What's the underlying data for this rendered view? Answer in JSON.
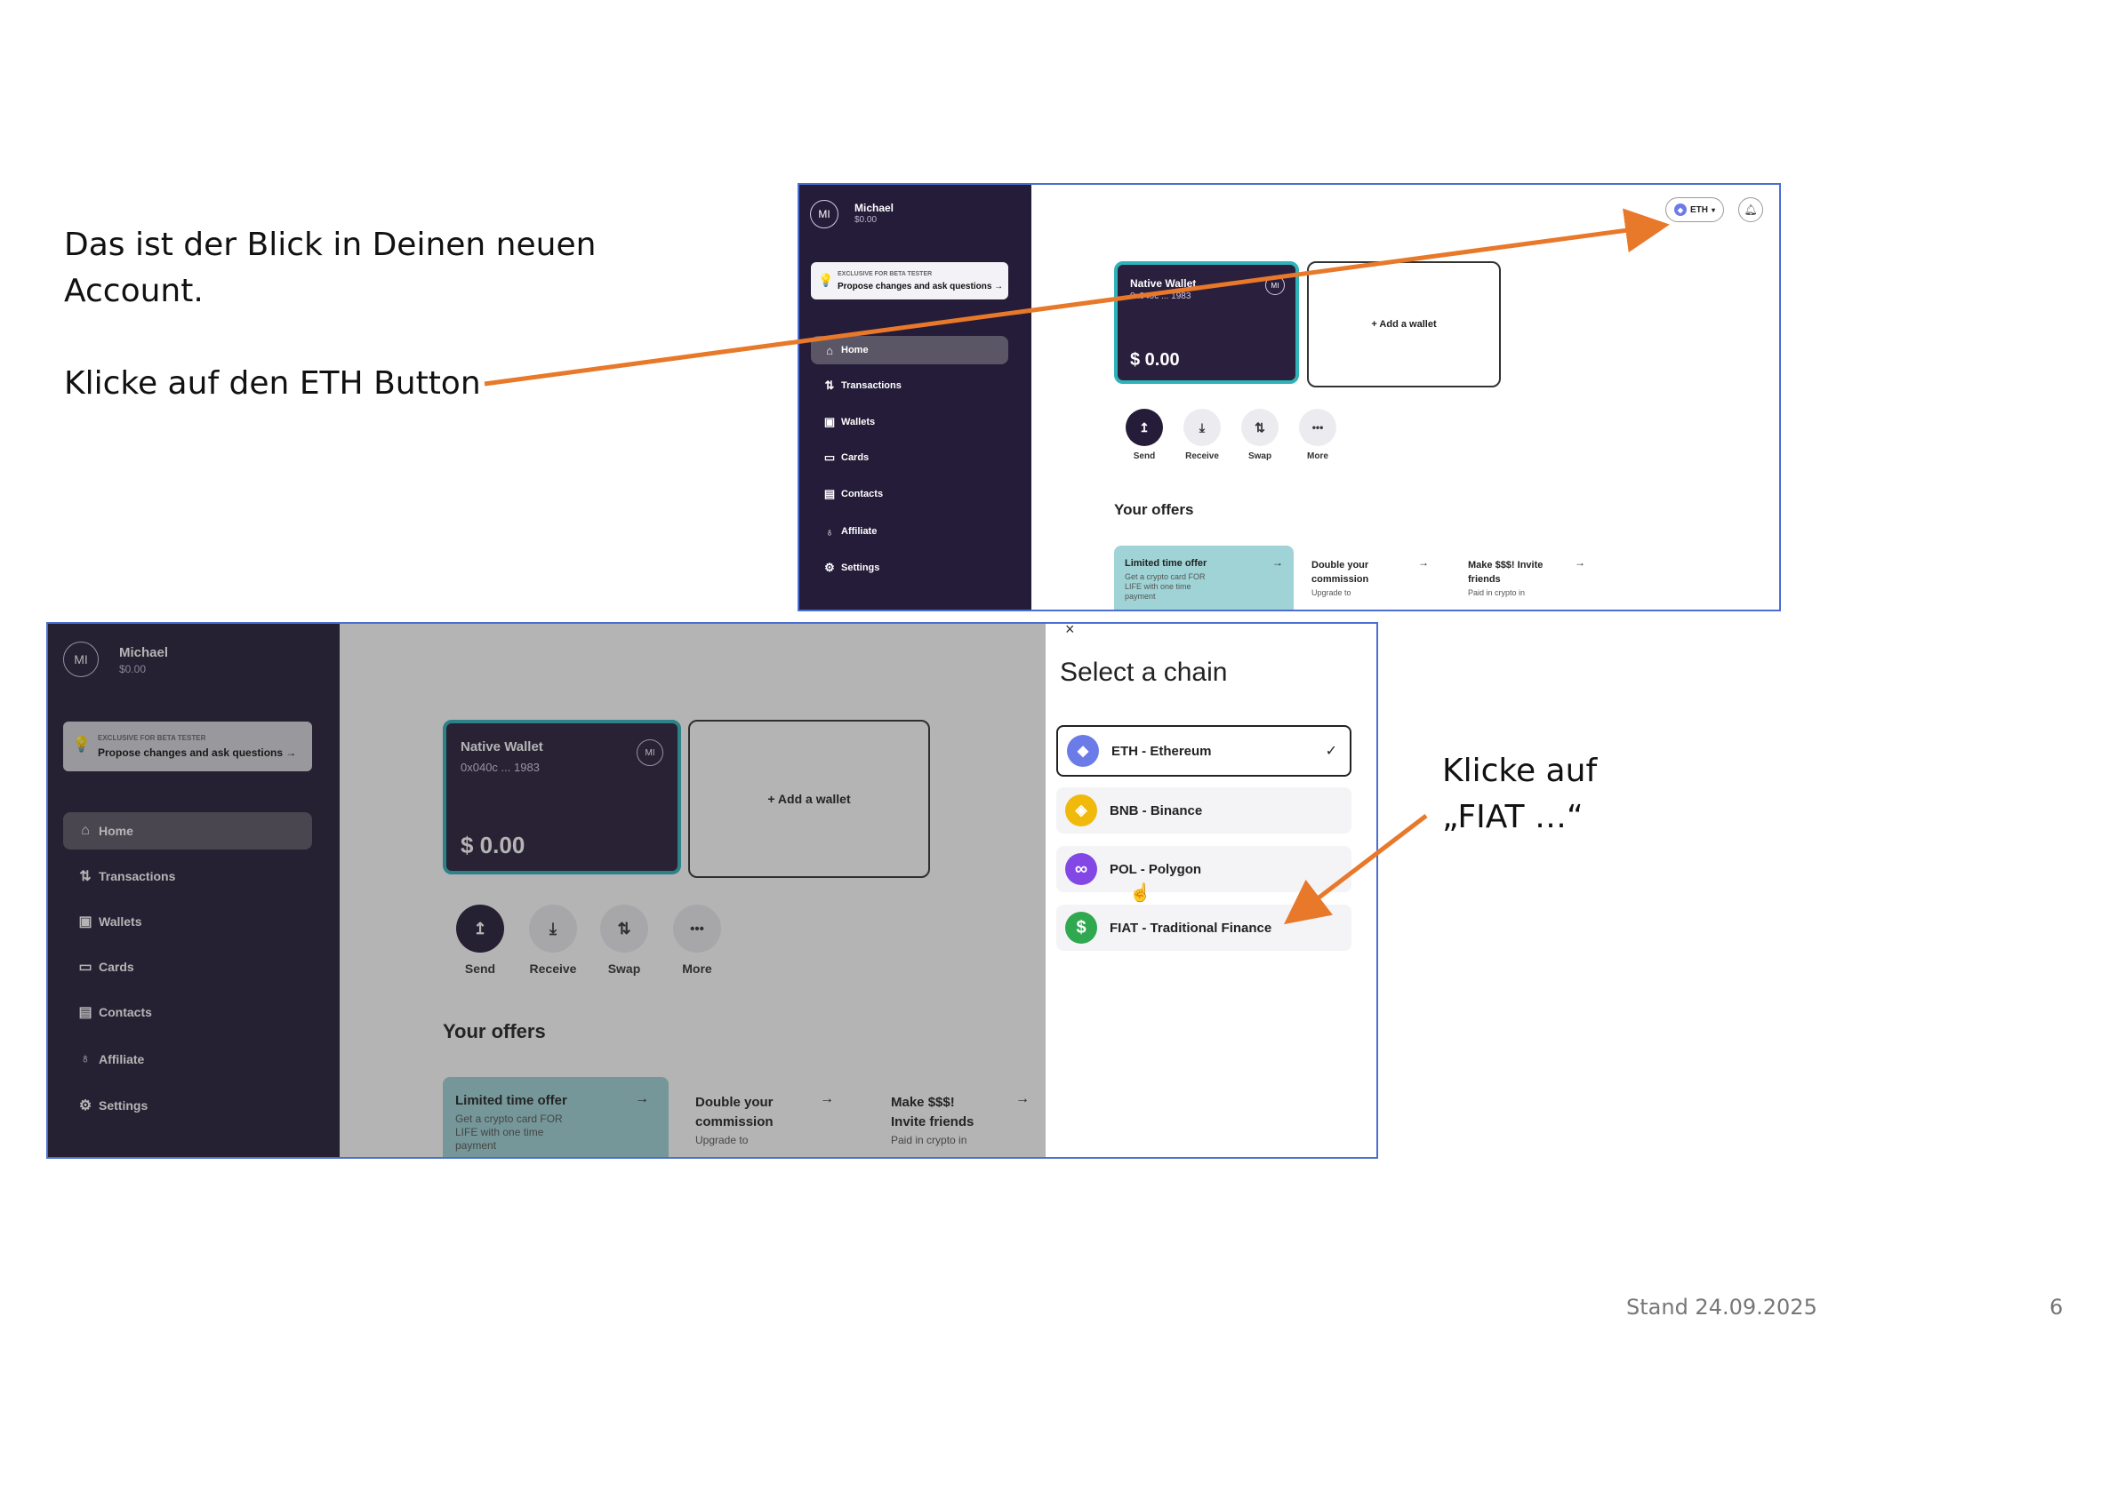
{
  "slide": {
    "intro_line1": "Das ist der Blick in Deinen neuen",
    "intro_line2": "Account.",
    "step1": "Klicke auf den ETH Button",
    "step2_line1": "Klicke auf",
    "step2_line2": "„FIAT …“",
    "footer_date": "Stand 24.09.2025",
    "page_number": "6"
  },
  "app": {
    "user": {
      "initials": "MI",
      "name": "Michael",
      "balance": "$0.00"
    },
    "beta": {
      "small": "EXCLUSIVE FOR BETA TESTER",
      "big": "Propose changes and ask questions →"
    },
    "nav": [
      {
        "label": "Home",
        "icon": "home-icon",
        "glyph": "⌂"
      },
      {
        "label": "Transactions",
        "icon": "transactions-icon",
        "glyph": "⇅"
      },
      {
        "label": "Wallets",
        "icon": "wallet-icon",
        "glyph": "▣"
      },
      {
        "label": "Cards",
        "icon": "card-icon",
        "glyph": "▭"
      },
      {
        "label": "Contacts",
        "icon": "contacts-icon",
        "glyph": "▤"
      },
      {
        "label": "Affiliate",
        "icon": "moneybag-icon",
        "glyph": "♁"
      },
      {
        "label": "Settings",
        "icon": "gear-icon",
        "glyph": "⚙"
      }
    ],
    "chain_button": "ETH",
    "wallet": {
      "name": "Native Wallet",
      "address": "0x040c ... 1983",
      "balance": "$ 0.00",
      "badge": "MI"
    },
    "add_wallet": "+ Add a wallet",
    "actions": [
      {
        "label": "Send",
        "glyph": "↥"
      },
      {
        "label": "Receive",
        "glyph": "⤓"
      },
      {
        "label": "Swap",
        "glyph": "⇅"
      },
      {
        "label": "More",
        "glyph": "•••"
      }
    ],
    "offers_title": "Your offers",
    "offers": [
      {
        "title": "Limited time offer",
        "desc": "Get a crypto card FOR LIFE with one time payment",
        "arrow": "→"
      },
      {
        "title": "Double your commission",
        "desc": "Upgrade to",
        "arrow": "→"
      },
      {
        "title": "Make $$$! Invite friends",
        "desc": "Paid in crypto in",
        "arrow": "→"
      }
    ]
  },
  "chain_panel": {
    "close": "×",
    "title": "Select a chain",
    "chains": [
      {
        "label": "ETH - Ethereum",
        "icon": "ethereum-icon",
        "glyph": "◆",
        "color": "#6b7ce8",
        "selected": true
      },
      {
        "label": "BNB - Binance",
        "icon": "binance-icon",
        "glyph": "◈",
        "color": "#f0b90b",
        "selected": false
      },
      {
        "label": "POL - Polygon",
        "icon": "polygon-icon",
        "glyph": "∞",
        "color": "#8247e5",
        "selected": false
      },
      {
        "label": "FIAT - Traditional Finance",
        "icon": "dollar-icon",
        "glyph": "$",
        "color": "#2fa84f",
        "selected": false
      }
    ],
    "check": "✓"
  },
  "colors": {
    "annotation_arrow": "#e8782a",
    "frame": "#4a6fd1",
    "sidebar": "#241c38",
    "wallet_border": "#2fb3b8"
  }
}
